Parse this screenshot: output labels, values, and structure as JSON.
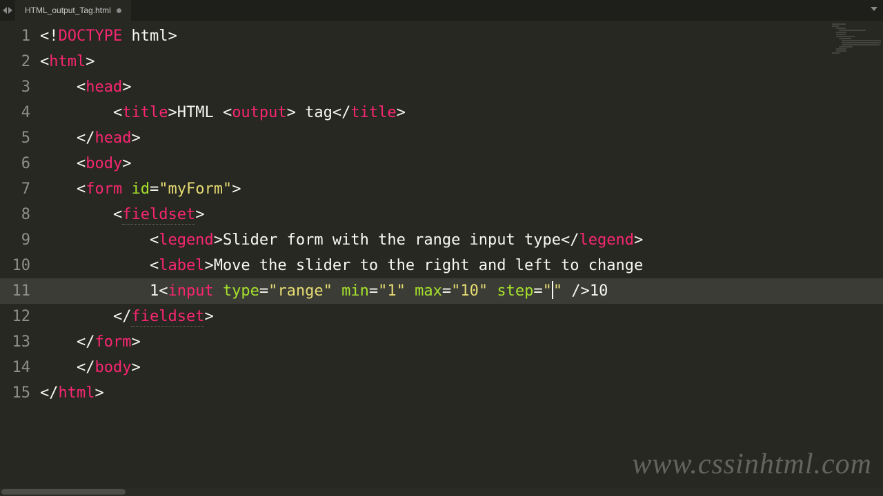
{
  "tab": {
    "filename": "HTML_output_Tag.html",
    "dirty": true
  },
  "gutter": {
    "lines": [
      "1",
      "2",
      "3",
      "4",
      "5",
      "6",
      "7",
      "8",
      "9",
      "10",
      "11",
      "12",
      "13",
      "14",
      "15"
    ],
    "highlighted": 11
  },
  "code": {
    "l1": {
      "br": "<",
      "bang": "!",
      "doctype": "DOCTYPE",
      "sp": " ",
      "html": "html",
      "cl": ">"
    },
    "l2": {
      "br": "<",
      "tag": "html",
      "cl": ">"
    },
    "l3": {
      "ind": "    ",
      "br": "<",
      "tag": "head",
      "cl": ">"
    },
    "l4": {
      "ind": "        ",
      "br": "<",
      "tag": "title",
      "cl": ">",
      "txt1": "HTML ",
      "br2": "<",
      "tag2": "output",
      "cl2": ">",
      "txt2": " tag",
      "br3": "</",
      "tag3": "title",
      "cl3": ">"
    },
    "l5": {
      "ind": "    ",
      "br": "</",
      "tag": "head",
      "cl": ">"
    },
    "l6": {
      "ind": "    ",
      "br": "<",
      "tag": "body",
      "cl": ">"
    },
    "l7": {
      "ind": "    ",
      "br": "<",
      "tag": "form",
      "sp": " ",
      "attr": "id",
      "eq": "=",
      "val": "\"myForm\"",
      "cl": ">"
    },
    "l8": {
      "ind": "        ",
      "br": "<",
      "tag": "fieldset",
      "cl": ">"
    },
    "l9": {
      "ind": "            ",
      "br": "<",
      "tag": "legend",
      "cl": ">",
      "txt": "Slider form with the range input type",
      "br2": "</",
      "tag2": "legend",
      "cl2": ">"
    },
    "l10": {
      "ind": "            ",
      "br": "<",
      "tag": "label",
      "cl": ">",
      "txt": "Move the slider to the right and left to change"
    },
    "l11": {
      "ind": "            ",
      "txt1": "1",
      "br": "<",
      "tag": "input",
      "sp": " ",
      "a1": "type",
      "eq1": "=",
      "v1": "\"range\"",
      "sp2": " ",
      "a2": "min",
      "eq2": "=",
      "v2": "\"1\"",
      "sp3": " ",
      "a3": "max",
      "eq3": "=",
      "v3": "\"10\"",
      "sp4": " ",
      "a4": "step",
      "eq4": "=",
      "v4a": "\"",
      "v4b": "\"",
      "sp5": " ",
      "cl": "/>",
      "txt2": "10"
    },
    "l12": {
      "ind": "        ",
      "br": "</",
      "tag": "fieldset",
      "cl": ">"
    },
    "l13": {
      "ind": "    ",
      "br": "</",
      "tag": "form",
      "cl": ">"
    },
    "l14": {
      "ind": "    ",
      "br": "</",
      "tag": "body",
      "cl": ">"
    },
    "l15": {
      "br": "</",
      "tag": "html",
      "cl": ">"
    }
  },
  "watermark": "www.cssinhtml.com"
}
